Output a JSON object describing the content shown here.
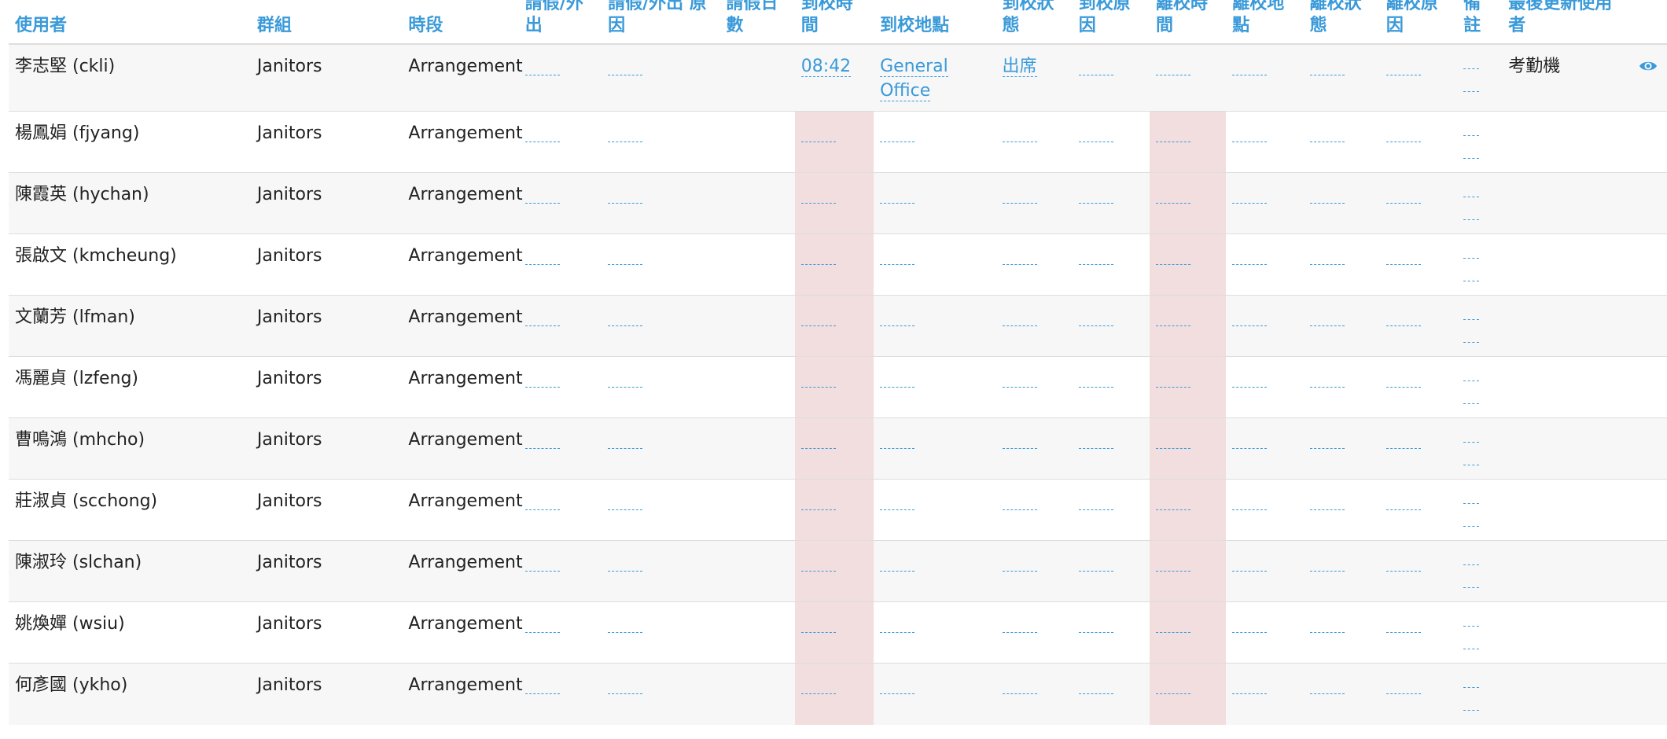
{
  "colors": {
    "accent": "#3a9ad9",
    "highlight": "#f2dede",
    "stripe": "#f7f7f7"
  },
  "headers": {
    "user": "使用者",
    "group": "群組",
    "slot": "時段",
    "leave": "請假/外出",
    "leave_reason": "請假/外出 原因",
    "leave_days": "請假日數",
    "arrive_time": "到校時間",
    "arrive_location": "到校地點",
    "arrive_status": "到校狀態",
    "arrive_reason": "到校原因",
    "depart_time": "離校時間",
    "depart_location": "離校地點",
    "depart_status": "離校狀態",
    "depart_reason": "離校原因",
    "remark": "備註",
    "updated_by": "最後更新使用者"
  },
  "rows": [
    {
      "user": "李志堅 (ckli)",
      "group": "Janitors",
      "slot": "Arrangement",
      "arrive_time": "08:42",
      "arrive_location": "General Office",
      "arrive_status": "出席",
      "updated_by": "考勤機",
      "action_icon": "eye-icon"
    },
    {
      "user": "楊鳳娟 (fjyang)",
      "group": "Janitors",
      "slot": "Arrangement"
    },
    {
      "user": "陳霞英 (hychan)",
      "group": "Janitors",
      "slot": "Arrangement"
    },
    {
      "user": "張啟文 (kmcheung)",
      "group": "Janitors",
      "slot": "Arrangement"
    },
    {
      "user": "文蘭芳 (lfman)",
      "group": "Janitors",
      "slot": "Arrangement"
    },
    {
      "user": "馮麗貞 (lzfeng)",
      "group": "Janitors",
      "slot": "Arrangement"
    },
    {
      "user": "曹鳴鴻 (mhcho)",
      "group": "Janitors",
      "slot": "Arrangement"
    },
    {
      "user": "莊淑貞 (scchong)",
      "group": "Janitors",
      "slot": "Arrangement"
    },
    {
      "user": "陳淑玲 (slchan)",
      "group": "Janitors",
      "slot": "Arrangement"
    },
    {
      "user": "姚煥嬋 (wsiu)",
      "group": "Janitors",
      "slot": "Arrangement"
    },
    {
      "user": "何彥國 (ykho)",
      "group": "Janitors",
      "slot": "Arrangement"
    }
  ]
}
